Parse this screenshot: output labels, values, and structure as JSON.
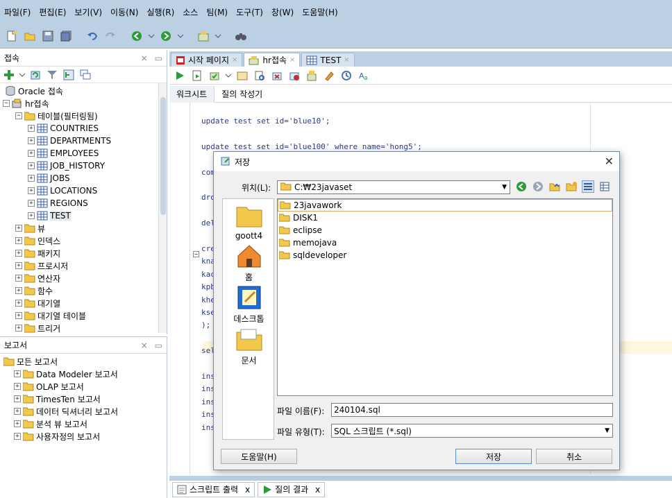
{
  "menu": [
    "파일(F)",
    "편집(E)",
    "보기(V)",
    "이동(N)",
    "실행(R)",
    "소스",
    "팀(M)",
    "도구(T)",
    "창(W)",
    "도움말(H)"
  ],
  "connections_panel": {
    "title": "접속",
    "tree": [
      {
        "label": "Oracle 접속",
        "level": 0,
        "icon": "database-icon",
        "expander": ""
      },
      {
        "label": "hr접속",
        "level": 0,
        "icon": "connection-icon",
        "expander": "-"
      },
      {
        "label": "테이블(필터링됨)",
        "level": 1,
        "icon": "tables-folder-icon",
        "expander": "-"
      },
      {
        "label": "COUNTRIES",
        "level": 2,
        "icon": "table-icon",
        "expander": "+"
      },
      {
        "label": "DEPARTMENTS",
        "level": 2,
        "icon": "table-icon",
        "expander": "+"
      },
      {
        "label": "EMPLOYEES",
        "level": 2,
        "icon": "table-icon",
        "expander": "+"
      },
      {
        "label": "JOB_HISTORY",
        "level": 2,
        "icon": "table-icon",
        "expander": "+"
      },
      {
        "label": "JOBS",
        "level": 2,
        "icon": "table-icon",
        "expander": "+"
      },
      {
        "label": "LOCATIONS",
        "level": 2,
        "icon": "table-icon",
        "expander": "+"
      },
      {
        "label": "REGIONS",
        "level": 2,
        "icon": "table-icon",
        "expander": "+"
      },
      {
        "label": "TEST",
        "level": 2,
        "icon": "table-icon",
        "expander": "+",
        "selected": true
      },
      {
        "label": "뷰",
        "level": 1,
        "icon": "views-folder-icon",
        "expander": "+"
      },
      {
        "label": "인덱스",
        "level": 1,
        "icon": "indexes-folder-icon",
        "expander": "+"
      },
      {
        "label": "패키지",
        "level": 1,
        "icon": "packages-folder-icon",
        "expander": "+"
      },
      {
        "label": "프로시저",
        "level": 1,
        "icon": "procedures-folder-icon",
        "expander": "+"
      },
      {
        "label": "연산자",
        "level": 1,
        "icon": "operators-folder-icon",
        "expander": "+"
      },
      {
        "label": "함수",
        "level": 1,
        "icon": "functions-folder-icon",
        "expander": "+"
      },
      {
        "label": "대기열",
        "level": 1,
        "icon": "queues-folder-icon",
        "expander": "+"
      },
      {
        "label": "대기열 테이블",
        "level": 1,
        "icon": "queue-tables-folder-icon",
        "expander": "+"
      },
      {
        "label": "트리거",
        "level": 1,
        "icon": "triggers-folder-icon",
        "expander": "+"
      }
    ]
  },
  "reports_panel": {
    "title": "보고서",
    "items": [
      {
        "label": "모든 보고서",
        "level": 0,
        "expander": ""
      },
      {
        "label": "Data Modeler 보고서",
        "level": 1,
        "expander": "+"
      },
      {
        "label": "OLAP 보고서",
        "level": 1,
        "expander": "+"
      },
      {
        "label": "TimesTen 보고서",
        "level": 1,
        "expander": "+"
      },
      {
        "label": "데이터 딕셔너리 보고서",
        "level": 1,
        "expander": "+"
      },
      {
        "label": "분석 뷰 보고서",
        "level": 1,
        "expander": "+"
      },
      {
        "label": "사용자정의 보고서",
        "level": 1,
        "expander": "+"
      }
    ]
  },
  "editor_tabs": [
    {
      "label": "시작 페이지",
      "icon": "start-page-icon",
      "active": false
    },
    {
      "label": "hr접속",
      "icon": "sql-worksheet-icon",
      "active": true
    },
    {
      "label": "TEST",
      "icon": "table-icon",
      "active": false
    }
  ],
  "sub_tabs": [
    "워크시트",
    "질의 작성기"
  ],
  "code_lines": [
    {
      "text": "update test set id='blue10';",
      "line": 0
    },
    {
      "text": "update test set id='blue100' where name='hong5';",
      "line": 2
    },
    {
      "text": "com",
      "line": 4
    },
    {
      "text": "dro",
      "line": 6
    },
    {
      "text": "del",
      "line": 8
    },
    {
      "text": "cre",
      "line": 10
    },
    {
      "text": "kna",
      "line": 11
    },
    {
      "text": "kac",
      "line": 12
    },
    {
      "text": "kpb",
      "line": 13
    },
    {
      "text": "khe",
      "line": 14
    },
    {
      "text": "kse",
      "line": 15
    },
    {
      "text": ");",
      "line": 16
    },
    {
      "text": "sel",
      "line": 18
    },
    {
      "text": "ins",
      "line": 20
    },
    {
      "text": "ins",
      "line": 21
    },
    {
      "text": "ins",
      "line": 22
    },
    {
      "text": "ins",
      "line": 23
    },
    {
      "text": "ins",
      "line": 24
    }
  ],
  "bottom_tabs": [
    {
      "label": "스크립트 출력",
      "icon": "script-output-icon"
    },
    {
      "label": "질의 결과",
      "icon": "query-result-icon"
    }
  ],
  "dialog": {
    "title": "저장",
    "look_in_label": "위치(L):",
    "look_in_value": "C:₩23javaset",
    "places": [
      "goott4",
      "홈",
      "데스크톱",
      "문서"
    ],
    "files": [
      {
        "name": "23javawork",
        "selected": true
      },
      {
        "name": "DISK1",
        "selected": false
      },
      {
        "name": "eclipse",
        "selected": false
      },
      {
        "name": "memojava",
        "selected": false
      },
      {
        "name": "sqldeveloper",
        "selected": false
      }
    ],
    "filename_label": "파일 이름(F):",
    "filename_value": "240104.sql",
    "filetype_label": "파일 유형(T):",
    "filetype_value": "SQL 스크립트 (*.sql)",
    "help_button": "도움말(H)",
    "save_button": "저장",
    "cancel_button": "취소"
  },
  "colors": {
    "chrome": "#bcd0e4",
    "folder": "#f2c94c",
    "table": "#3b5ea8",
    "code_text": "#2a3a8a",
    "highlight_line": "#fdf7dd",
    "default_button_border": "#5a8dd6"
  }
}
